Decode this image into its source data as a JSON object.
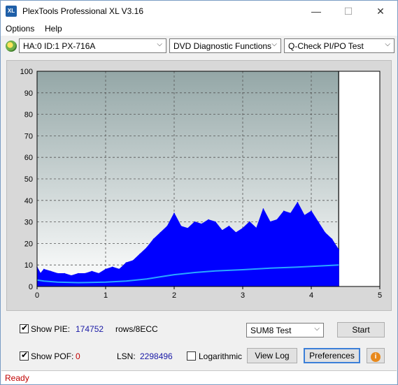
{
  "window": {
    "title": "PlexTools Professional XL V3.16",
    "icon_text": "XL",
    "minimize": "—",
    "maximize": "☐",
    "close": "✕"
  },
  "menu": {
    "options": "Options",
    "help": "Help"
  },
  "toolbar": {
    "drive": "HA:0 ID:1  PX-716A",
    "function": "DVD Diagnostic Functions",
    "test": "Q-Check PI/PO Test"
  },
  "chart_data": {
    "type": "area",
    "x_ticks": [
      "0",
      "1",
      "2",
      "3",
      "4",
      "5"
    ],
    "y_ticks": [
      "0",
      "10",
      "20",
      "30",
      "40",
      "50",
      "60",
      "70",
      "80",
      "90",
      "100"
    ],
    "xlim": [
      0,
      5
    ],
    "ylim": [
      0,
      100
    ],
    "scan_end_x": 4.4,
    "grid": true,
    "colors": {
      "pie_fill": "#0000ff",
      "pie_avg_line": "#29a8ff",
      "plot_bg_top": "#94a7a7",
      "plot_bg_bottom": "#ffffff"
    },
    "series": [
      {
        "type": "area",
        "x": [
          0,
          0.05,
          0.1,
          0.2,
          0.3,
          0.4,
          0.5,
          0.6,
          0.7,
          0.8,
          0.9,
          1.0,
          1.1,
          1.2,
          1.3,
          1.4,
          1.5,
          1.6,
          1.7,
          1.8,
          1.9,
          2.0,
          2.1,
          2.2,
          2.3,
          2.4,
          2.5,
          2.6,
          2.7,
          2.8,
          2.9,
          3.0,
          3.1,
          3.2,
          3.3,
          3.4,
          3.5,
          3.6,
          3.7,
          3.8,
          3.9,
          4.0,
          4.1,
          4.2,
          4.3,
          4.4
        ],
        "y": [
          9,
          6,
          8,
          7,
          6,
          6,
          5,
          6,
          6,
          7,
          6,
          8,
          9,
          8,
          11,
          12,
          15,
          18,
          22,
          25,
          28,
          34,
          28,
          27,
          30,
          29,
          31,
          30,
          26,
          28,
          25,
          27,
          30,
          27,
          36,
          30,
          31,
          35,
          34,
          39,
          33,
          35,
          30,
          25,
          22,
          17
        ]
      },
      {
        "type": "line",
        "x": [
          0,
          0.1,
          0.3,
          0.6,
          1.0,
          1.3,
          1.6,
          1.8,
          2.0,
          2.3,
          2.6,
          3.0,
          3.4,
          3.8,
          4.1,
          4.4
        ],
        "y": [
          3,
          2.5,
          2,
          1.8,
          2,
          2.5,
          3.5,
          4.5,
          5.5,
          6.5,
          7.2,
          7.8,
          8.5,
          9,
          9.5,
          10
        ]
      }
    ]
  },
  "controls": {
    "show_pie_label": "Show PIE:",
    "pie_value": "174752",
    "pie_unit": "rows/8ECC",
    "show_pof_label": "Show POF:",
    "pof_value": "0",
    "lsn_label": "LSN:",
    "lsn_value": "2298496",
    "logarithmic_label": "Logarithmic",
    "sum8_select": "SUM8 Test",
    "start_button": "Start",
    "viewlog_button": "View Log",
    "preferences_button": "Preferences",
    "info_icon": "i"
  },
  "status": {
    "text": "Ready"
  }
}
